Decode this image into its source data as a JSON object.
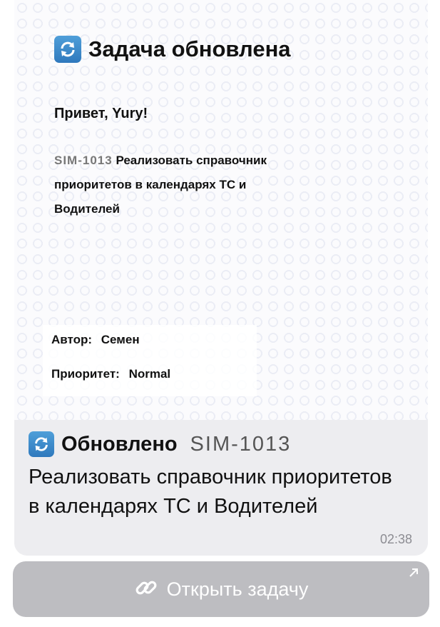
{
  "card": {
    "title": "Задача обновлена",
    "greeting": "Привет, Yury!",
    "task_key": "SIM-1013",
    "task_title": "Реализовать справочник приоритетов в календарях ТС и Водителей",
    "author_label": "Автор:",
    "author_value": "Семен",
    "priority_label": "Приоритет:",
    "priority_value": "Normal"
  },
  "message": {
    "heading": "Обновлено",
    "task_key": "SIM-1013",
    "body": "Реализовать справочник приоритетов в календарях ТС и Водителей",
    "time": "02:38"
  },
  "button": {
    "label": "Открыть задачу",
    "icon": "link-icon",
    "corner_icon": "arrow-up-right-icon"
  },
  "colors": {
    "icon_blue": "#3b8bd0",
    "bubble_bg": "#ededf0",
    "button_bg": "#bdbdc1"
  }
}
